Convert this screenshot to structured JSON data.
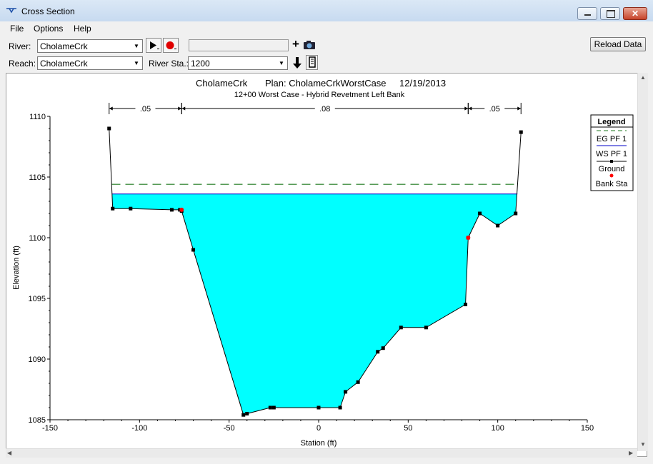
{
  "window": {
    "title": "Cross Section"
  },
  "menu": [
    "File",
    "Options",
    "Help"
  ],
  "toolbar": {
    "river_label": "River:",
    "river_value": "CholameCrk",
    "reach_label": "Reach:",
    "reach_value": "CholameCrk",
    "river_sta_label": "River Sta.:",
    "river_sta_value": "1200",
    "reload_label": "Reload Data",
    "plus_symbol": "+"
  },
  "colors": {
    "water": "#00ffff",
    "eg_line": "#1f7a1f",
    "ws_line": "#0000c8",
    "ground": "#000000",
    "bank": "#ff0000"
  },
  "chart_data": {
    "type": "area",
    "title_river": "CholameCrk",
    "title_plan": "Plan: CholameCrkWorstCase",
    "title_date": "12/19/2013",
    "subtitle": "12+00 Worst Case - Hybrid Revetment Left Bank",
    "xlabel": "Station (ft)",
    "ylabel": "Elevation (ft)",
    "xlim": [
      -150,
      150
    ],
    "ylim": [
      1085,
      1110
    ],
    "xticks": [
      -150,
      -100,
      -50,
      0,
      50,
      100,
      150
    ],
    "yticks": [
      1085,
      1090,
      1095,
      1100,
      1105,
      1110
    ],
    "ground": {
      "x": [
        -117,
        -115,
        -105,
        -82,
        -77.5,
        -76.5,
        -70,
        -42,
        -40,
        -27,
        -25,
        0,
        12,
        15,
        22,
        33,
        36,
        46,
        60,
        82,
        83.5,
        90,
        100,
        110,
        113
      ],
      "y": [
        1109,
        1102.4,
        1102.4,
        1102.3,
        1102.3,
        1102.2,
        1099,
        1085.4,
        1085.5,
        1086,
        1086,
        1086,
        1086,
        1087.3,
        1088.1,
        1090.6,
        1090.9,
        1092.6,
        1092.6,
        1094.5,
        1100,
        1102,
        1101,
        1102,
        1108.7
      ]
    },
    "bank_stations": [
      {
        "x": -76.5,
        "y": 1102.3
      },
      {
        "x": 83.5,
        "y": 1100
      }
    ],
    "ws_elevation": 1103.6,
    "eg_elevation": 1104.4,
    "ws_extent": [
      -115.5,
      111
    ],
    "manning_n": [
      {
        "from": -117,
        "to": -76.5,
        "label": ".05"
      },
      {
        "from": -76.5,
        "to": 83.5,
        "label": ".08"
      },
      {
        "from": 83.5,
        "to": 113,
        "label": ".05"
      }
    ],
    "legend": {
      "title": "Legend",
      "items": [
        "EG PF 1",
        "WS PF 1",
        "Ground",
        "Bank Sta"
      ],
      "placement": "right"
    }
  }
}
